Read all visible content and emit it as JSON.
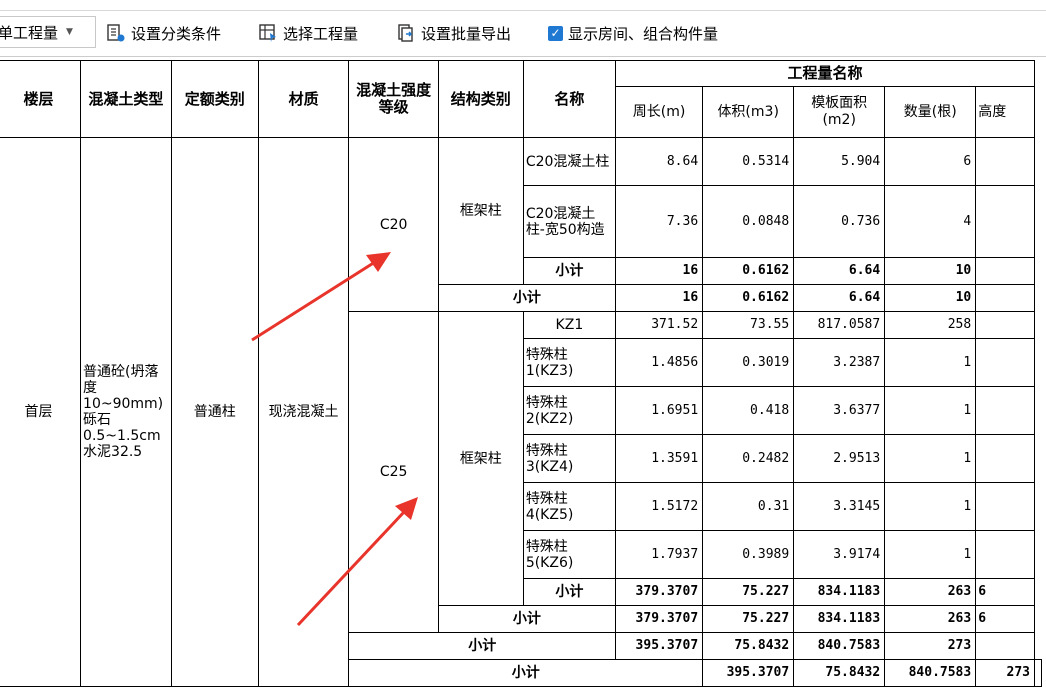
{
  "toolbar": {
    "dropdown_value": "单工程量",
    "btn_category": "设置分类条件",
    "btn_select": "选择工程量",
    "btn_export": "设置批量导出",
    "chk_label": "显示房间、组合构件量",
    "chk_checked": true
  },
  "headers": {
    "floor": "楼层",
    "concrete_type": "混凝土类型",
    "quota_category": "定额类别",
    "material": "材质",
    "strength_grade": "混凝土强度等级",
    "structure_type": "结构类别",
    "name": "名称",
    "quantity_group": "工程量名称",
    "perimeter": "周长(m)",
    "volume": "体积(m3)",
    "formwork_area": "模板面积(m2)",
    "count": "数量(根)",
    "height": "高度"
  },
  "cells": {
    "floor": "首层",
    "concrete_type": "普通砼(坍落度10~90mm) 砾石0.5~1.5cm水泥32.5",
    "quota_category": "普通柱",
    "material": "现浇混凝土",
    "grade_c20": "C20",
    "grade_c25": "C25",
    "struct_frame": "框架柱",
    "subtotal": "小计"
  },
  "rows_c20": [
    {
      "name": "C20混凝土柱",
      "perimeter": "8.64",
      "volume": "0.5314",
      "area": "5.904",
      "count": "6",
      "height": ""
    },
    {
      "name": "C20混凝土柱-宽50构造",
      "perimeter": "7.36",
      "volume": "0.0848",
      "area": "0.736",
      "count": "4",
      "height": ""
    }
  ],
  "subtotal_c20_struct": {
    "perimeter": "16",
    "volume": "0.6162",
    "area": "6.64",
    "count": "10",
    "height": ""
  },
  "subtotal_c20_grade": {
    "perimeter": "16",
    "volume": "0.6162",
    "area": "6.64",
    "count": "10",
    "height": ""
  },
  "rows_c25": [
    {
      "name": "KZ1",
      "perimeter": "371.52",
      "volume": "73.55",
      "area": "817.0587",
      "count": "258",
      "height": ""
    },
    {
      "name": "特殊柱1(KZ3)",
      "perimeter": "1.4856",
      "volume": "0.3019",
      "area": "3.2387",
      "count": "1",
      "height": ""
    },
    {
      "name": "特殊柱2(KZ2)",
      "perimeter": "1.6951",
      "volume": "0.418",
      "area": "3.6377",
      "count": "1",
      "height": ""
    },
    {
      "name": "特殊柱3(KZ4)",
      "perimeter": "1.3591",
      "volume": "0.2482",
      "area": "2.9513",
      "count": "1",
      "height": ""
    },
    {
      "name": "特殊柱4(KZ5)",
      "perimeter": "1.5172",
      "volume": "0.31",
      "area": "3.3145",
      "count": "1",
      "height": ""
    },
    {
      "name": "特殊柱5(KZ6)",
      "perimeter": "1.7937",
      "volume": "0.3989",
      "area": "3.9174",
      "count": "1",
      "height": ""
    }
  ],
  "subtotal_c25_struct": {
    "perimeter": "379.3707",
    "volume": "75.227",
    "area": "834.1183",
    "count": "263",
    "height": "6"
  },
  "subtotal_c25_grade": {
    "perimeter": "379.3707",
    "volume": "75.227",
    "area": "834.1183",
    "count": "263",
    "height": "6"
  },
  "subtotal_material": {
    "perimeter": "395.3707",
    "volume": "75.8432",
    "area": "840.7583",
    "count": "273",
    "height": ""
  },
  "subtotal_quota": {
    "perimeter": "395.3707",
    "volume": "75.8432",
    "area": "840.7583",
    "count": "273",
    "height": ""
  },
  "colors": {
    "arrow": "#e8342a",
    "checkbox": "#1f78d1"
  }
}
